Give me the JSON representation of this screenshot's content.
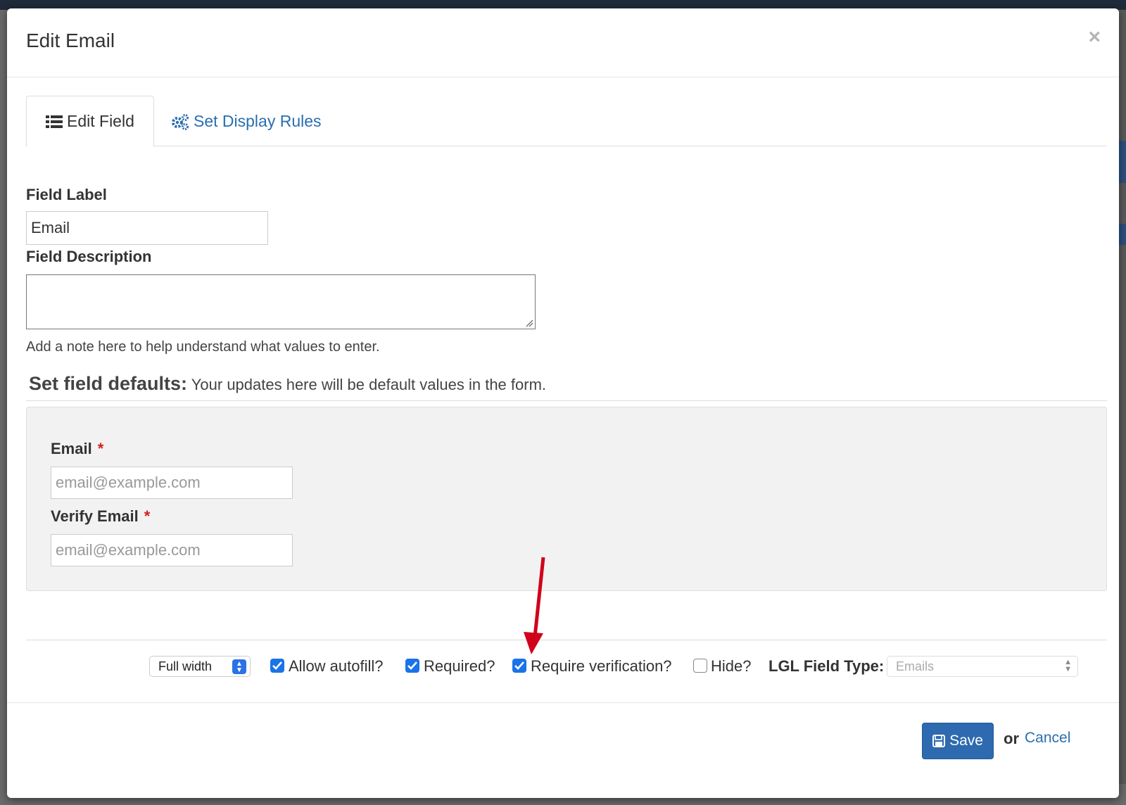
{
  "modal": {
    "title": "Edit Email",
    "close_glyph": "×"
  },
  "tabs": [
    {
      "label": "Edit Field",
      "icon": "list-icon",
      "active": true
    },
    {
      "label": "Set Display Rules",
      "icon": "gears-icon",
      "active": false
    }
  ],
  "field_label": {
    "label": "Field Label",
    "value": "Email"
  },
  "field_description": {
    "label": "Field Description",
    "value": "",
    "help": "Add a note here to help understand what values to enter."
  },
  "defaults": {
    "heading_strong": "Set field defaults:",
    "heading_text": "Your updates here will be default values in the form.",
    "email": {
      "label": "Email",
      "required_mark": "*",
      "placeholder": "email@example.com"
    },
    "verify_email": {
      "label": "Verify Email",
      "required_mark": "*",
      "placeholder": "email@example.com"
    }
  },
  "options": {
    "width_select": "Full width",
    "allow_autofill": {
      "label": "Allow autofill?",
      "checked": true
    },
    "required": {
      "label": "Required?",
      "checked": true
    },
    "require_verification": {
      "label": "Require verification?",
      "checked": true
    },
    "hide": {
      "label": "Hide?",
      "checked": false
    },
    "lgl_field_type_label": "LGL Field Type:",
    "lgl_field_type_value": "Emails"
  },
  "footer": {
    "save_label": "Save",
    "or_text": "or",
    "cancel_label": "Cancel"
  },
  "colors": {
    "primary": "#2d6ab0",
    "link": "#2a6eb0",
    "checkbox": "#1a73e8",
    "required": "#d21f1f",
    "annotation_arrow": "#d0021b"
  }
}
